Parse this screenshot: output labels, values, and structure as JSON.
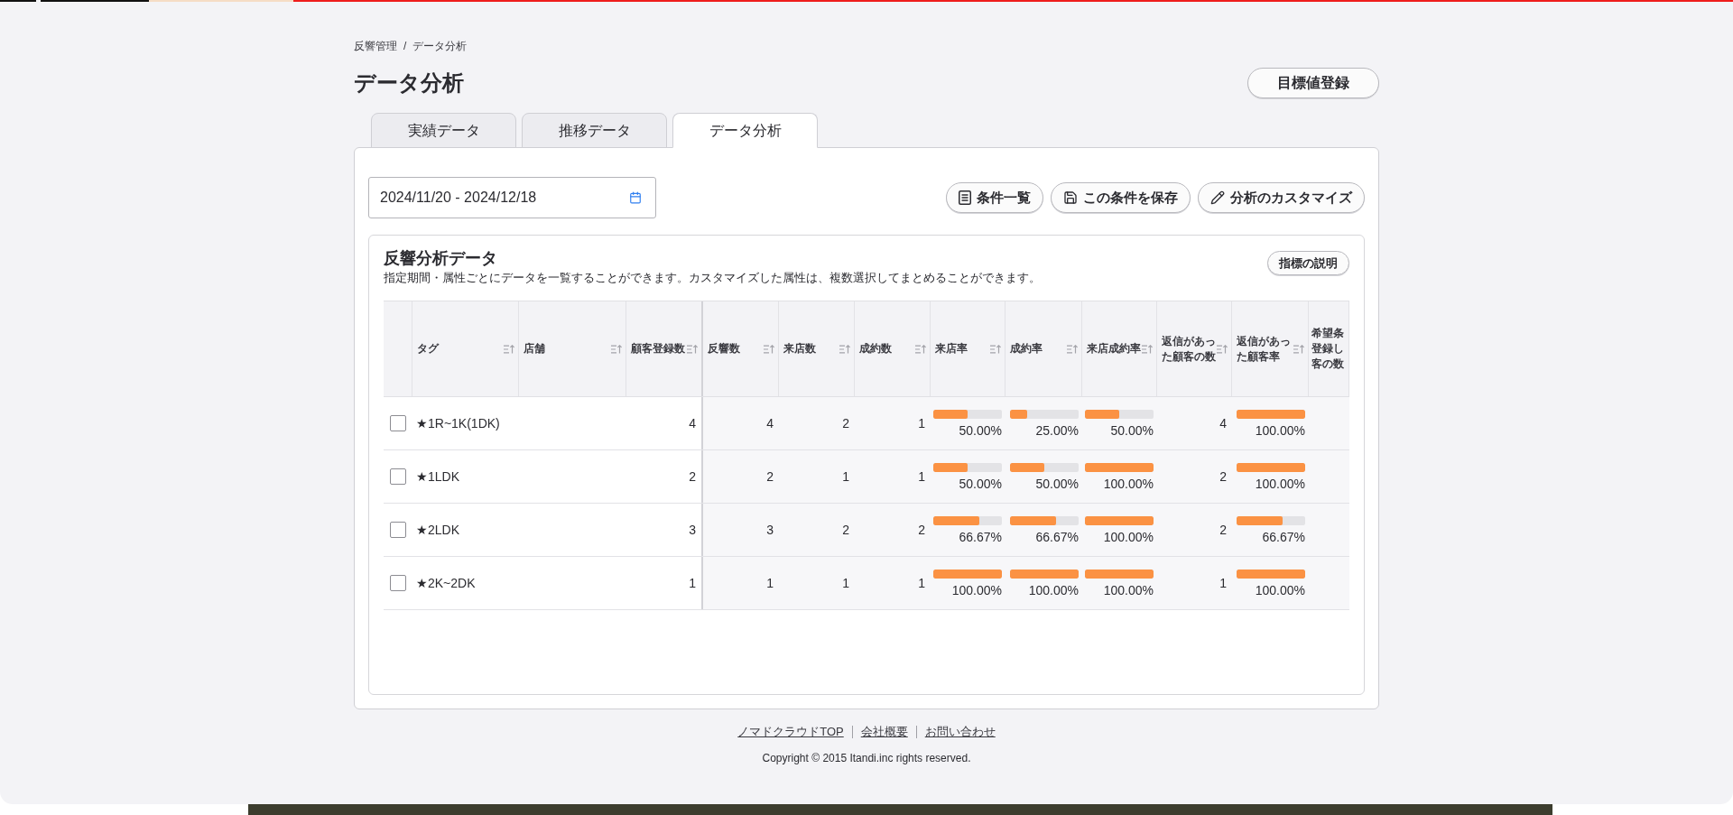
{
  "breadcrumb": {
    "items": [
      "反響管理",
      "データ分析"
    ],
    "separator": "/"
  },
  "page_title": "データ分析",
  "header_button": "目標値登録",
  "tabs": [
    {
      "label": "実績データ",
      "selected": false
    },
    {
      "label": "推移データ",
      "selected": false
    },
    {
      "label": "データ分析",
      "selected": true
    }
  ],
  "date_range": {
    "value": "2024/11/20 - 2024/12/18"
  },
  "toolbar_buttons": [
    "条件一覧",
    "この条件を保存",
    "分析のカスタマイズ"
  ],
  "analysis": {
    "title": "反響分析データ",
    "description": "指定期間・属性ごとにデータを一覧することができます。カスタマイズした属性は、複数選択してまとめることができます。",
    "help_button": "指標の説明",
    "table": {
      "columns": [
        {
          "label": "タグ",
          "sort_icon": true
        },
        {
          "label": "店舗",
          "sort_icon": true
        },
        {
          "label": "顧客登録数",
          "sort_icon": true
        },
        {
          "label": "反響数",
          "sort_icon": true
        },
        {
          "label": "来店数",
          "sort_icon": true
        },
        {
          "label": "成約数",
          "sort_icon": true
        },
        {
          "label": "来店率",
          "sort_icon": true
        },
        {
          "label": "成約率",
          "sort_icon": true
        },
        {
          "label": "来店成約率",
          "sort_icon": true
        },
        {
          "label": "返信があった顧客の数",
          "sort_icon": true
        },
        {
          "label": "返信があった顧客率",
          "sort_icon": true
        },
        {
          "label": "希望条登録し客の数",
          "sort_icon": false
        }
      ],
      "rows": [
        {
          "checked": false,
          "cells": [
            {
              "kind": "text",
              "value": "★1R~1K(1DK)"
            },
            null,
            {
              "kind": "number",
              "value": "4"
            },
            {
              "kind": "number",
              "value": "4"
            },
            {
              "kind": "number",
              "value": "2"
            },
            {
              "kind": "number",
              "value": "1"
            },
            {
              "kind": "rate",
              "value": "50.00%",
              "level": 0.5
            },
            {
              "kind": "rate",
              "value": "25.00%",
              "level": 0.25
            },
            {
              "kind": "rate",
              "value": "50.00%",
              "level": 0.5
            },
            {
              "kind": "number",
              "value": "4"
            },
            {
              "kind": "rate",
              "value": "100.00%",
              "level": 1
            },
            null
          ]
        },
        {
          "checked": false,
          "cells": [
            {
              "kind": "text",
              "value": "★1LDK"
            },
            null,
            {
              "kind": "number",
              "value": "2"
            },
            {
              "kind": "number",
              "value": "2"
            },
            {
              "kind": "number",
              "value": "1"
            },
            {
              "kind": "number",
              "value": "1"
            },
            {
              "kind": "rate",
              "value": "50.00%",
              "level": 0.5
            },
            {
              "kind": "rate",
              "value": "50.00%",
              "level": 0.5
            },
            {
              "kind": "rate",
              "value": "100.00%",
              "level": 1
            },
            {
              "kind": "number",
              "value": "2"
            },
            {
              "kind": "rate",
              "value": "100.00%",
              "level": 1
            },
            null
          ]
        },
        {
          "checked": false,
          "cells": [
            {
              "kind": "text",
              "value": "★2LDK"
            },
            null,
            {
              "kind": "number",
              "value": "3"
            },
            {
              "kind": "number",
              "value": "3"
            },
            {
              "kind": "number",
              "value": "2"
            },
            {
              "kind": "number",
              "value": "2"
            },
            {
              "kind": "rate",
              "value": "66.67%",
              "level": 0.6667
            },
            {
              "kind": "rate",
              "value": "66.67%",
              "level": 0.6667
            },
            {
              "kind": "rate",
              "value": "100.00%",
              "level": 1
            },
            {
              "kind": "number",
              "value": "2"
            },
            {
              "kind": "rate",
              "value": "66.67%",
              "level": 0.6667
            },
            null
          ]
        },
        {
          "checked": false,
          "cells": [
            {
              "kind": "text",
              "value": "★2K~2DK"
            },
            null,
            {
              "kind": "number",
              "value": "1"
            },
            {
              "kind": "number",
              "value": "1"
            },
            {
              "kind": "number",
              "value": "1"
            },
            {
              "kind": "number",
              "value": "1"
            },
            {
              "kind": "rate",
              "value": "100.00%",
              "level": 1
            },
            {
              "kind": "rate",
              "value": "100.00%",
              "level": 1
            },
            {
              "kind": "rate",
              "value": "100.00%",
              "level": 1
            },
            {
              "kind": "number",
              "value": "1"
            },
            {
              "kind": "rate",
              "value": "100.00%",
              "level": 1
            },
            null
          ]
        }
      ]
    }
  },
  "footer": {
    "links": [
      "ノマドクラウドTOP",
      "会社概要",
      "お問い合わせ"
    ],
    "copyright": "Copyright © 2015 Itandi.inc rights reserved."
  }
}
